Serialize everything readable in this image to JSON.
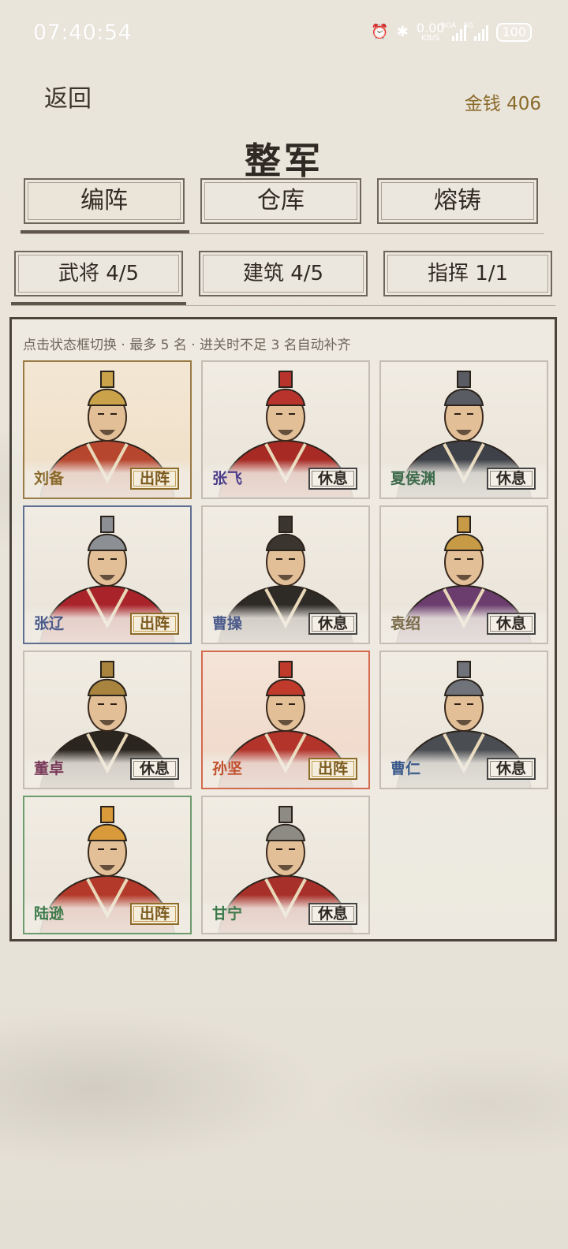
{
  "status_bar": {
    "time": "07:40:54",
    "net_speed": "0.00",
    "net_unit": "KB/S",
    "sim1": "5GA",
    "sim2": "5G",
    "battery": "100"
  },
  "header": {
    "back_label": "返回",
    "money_label": "金钱 406",
    "title": "整军"
  },
  "main_tabs": [
    {
      "label": "编阵",
      "active": true
    },
    {
      "label": "仓库",
      "active": false
    },
    {
      "label": "熔铸",
      "active": false
    }
  ],
  "sub_tabs": [
    {
      "label": "武将 4/5",
      "active": true
    },
    {
      "label": "建筑 4/5",
      "active": false
    },
    {
      "label": "指挥 1/1",
      "active": false
    }
  ],
  "hint": "点击状态框切换 · 最多 5 名 · 进关时不足 3 名自动补齐",
  "generals": [
    {
      "name": "刘备",
      "status": "出阵",
      "name_color": "#8a6a2a"
    },
    {
      "name": "张飞",
      "status": "休息",
      "name_color": "#4b3d8a"
    },
    {
      "name": "夏侯渊",
      "status": "休息",
      "name_color": "#3d6a4a"
    },
    {
      "name": "张辽",
      "status": "出阵",
      "name_color": "#4a5a8a"
    },
    {
      "name": "曹操",
      "status": "休息",
      "name_color": "#4a5a8a"
    },
    {
      "name": "袁绍",
      "status": "休息",
      "name_color": "#7a6a4a"
    },
    {
      "name": "董卓",
      "status": "休息",
      "name_color": "#7a3a5a"
    },
    {
      "name": "孙坚",
      "status": "出阵",
      "name_color": "#c0502e"
    },
    {
      "name": "曹仁",
      "status": "休息",
      "name_color": "#3a5a8a"
    },
    {
      "name": "陆逊",
      "status": "出阵",
      "name_color": "#3d7a4a"
    },
    {
      "name": "甘宁",
      "status": "休息",
      "name_color": "#3d7a4a"
    }
  ]
}
